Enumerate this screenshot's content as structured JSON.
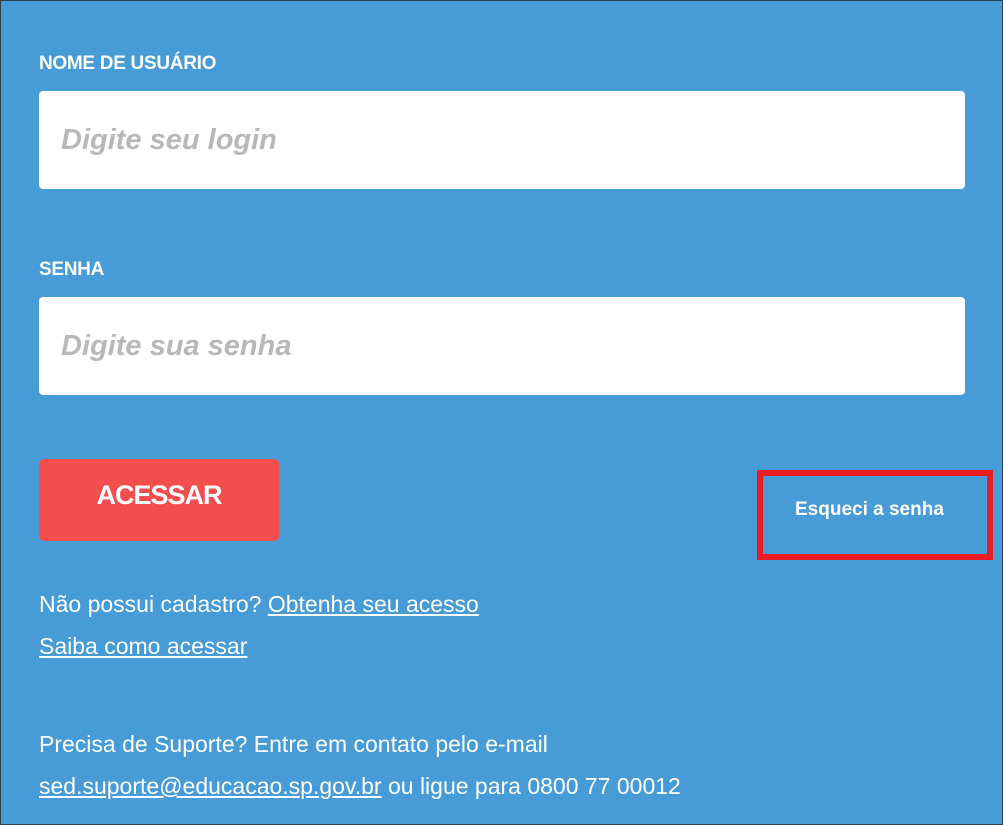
{
  "form": {
    "username_label": "NOME DE USUÁRIO",
    "username_placeholder": "Digite seu login",
    "password_label": "SENHA",
    "password_placeholder": "Digite sua senha",
    "submit_label": "ACESSAR",
    "forgot_password_label": "Esqueci a senha"
  },
  "links": {
    "no_account_text": "Não possui cadastro? ",
    "get_access_link": "Obtenha seu acesso",
    "how_to_access_link": "Saiba como acessar"
  },
  "support": {
    "intro_text": "Precisa de Suporte? Entre em contato pelo e-mail",
    "email_link": "sed.suporte@educacao.sp.gov.br",
    "phone_text": " ou ligue para 0800 77 00012"
  },
  "colors": {
    "panel_background": "#479bd6",
    "submit_button": "#f44d4d",
    "highlight_box": "#ec1c24"
  }
}
